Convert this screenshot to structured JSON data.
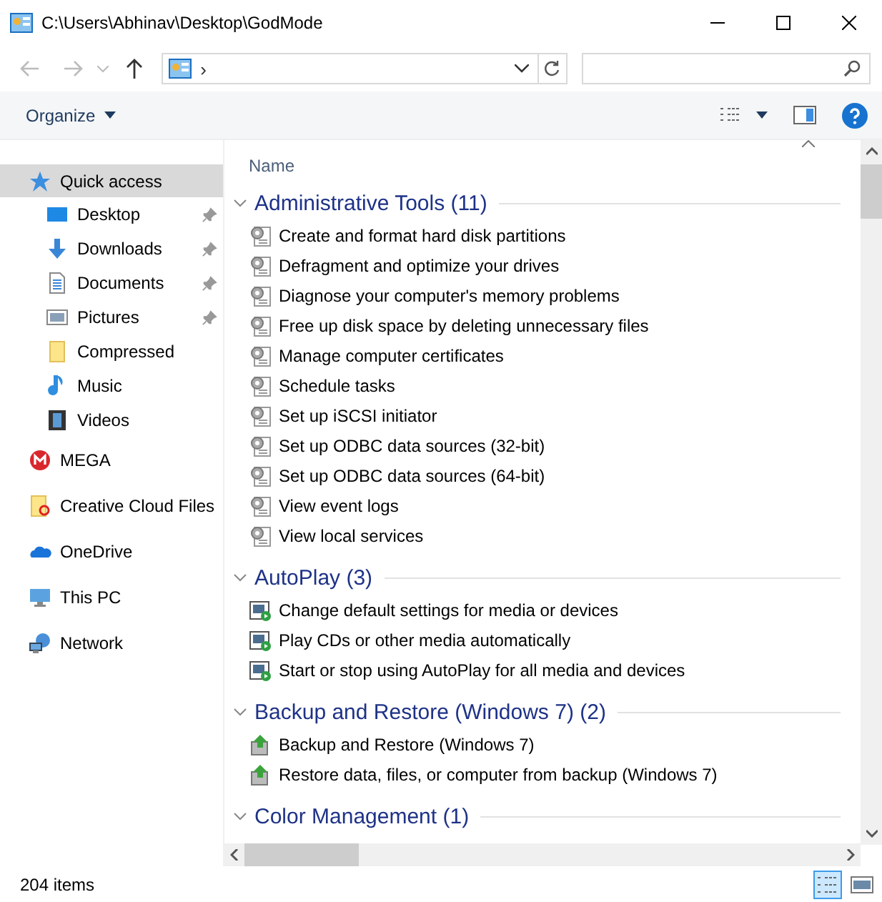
{
  "window": {
    "title": "C:\\Users\\Abhinav\\Desktop\\GodMode"
  },
  "address": {
    "crumb": "›"
  },
  "toolbar": {
    "organize": "Organize"
  },
  "sidebar": {
    "items": [
      {
        "label": "Quick access",
        "selected": true,
        "children": [
          {
            "label": "Desktop",
            "pinned": true
          },
          {
            "label": "Downloads",
            "pinned": true
          },
          {
            "label": "Documents",
            "pinned": true
          },
          {
            "label": "Pictures",
            "pinned": true
          },
          {
            "label": "Compressed",
            "pinned": false
          },
          {
            "label": "Music",
            "pinned": false
          },
          {
            "label": "Videos",
            "pinned": false
          }
        ]
      },
      {
        "label": "MEGA",
        "selected": false
      },
      {
        "label": "Creative Cloud Files",
        "selected": false
      },
      {
        "label": "OneDrive",
        "selected": false
      },
      {
        "label": "This PC",
        "selected": false
      },
      {
        "label": "Network",
        "selected": false
      }
    ]
  },
  "content": {
    "column": "Name",
    "groups": [
      {
        "title": "Administrative Tools (11)",
        "expanded": true,
        "items": [
          "Create and format hard disk partitions",
          "Defragment and optimize your drives",
          "Diagnose your computer's memory problems",
          "Free up disk space by deleting unnecessary files",
          "Manage computer certificates",
          "Schedule tasks",
          "Set up iSCSI initiator",
          "Set up ODBC data sources (32-bit)",
          "Set up ODBC data sources (64-bit)",
          "View event logs",
          "View local services"
        ]
      },
      {
        "title": "AutoPlay (3)",
        "expanded": true,
        "items": [
          "Change default settings for media or devices",
          "Play CDs or other media automatically",
          "Start or stop using AutoPlay for all media and devices"
        ]
      },
      {
        "title": "Backup and Restore (Windows 7) (2)",
        "expanded": true,
        "items": [
          "Backup and Restore (Windows 7)",
          "Restore data, files, or computer from backup (Windows 7)"
        ]
      },
      {
        "title": "Color Management (1)",
        "expanded": true
      }
    ]
  },
  "status_bar": {
    "count": "204 items",
    "views": [
      {
        "selected": true
      },
      {
        "selected": false
      }
    ]
  }
}
